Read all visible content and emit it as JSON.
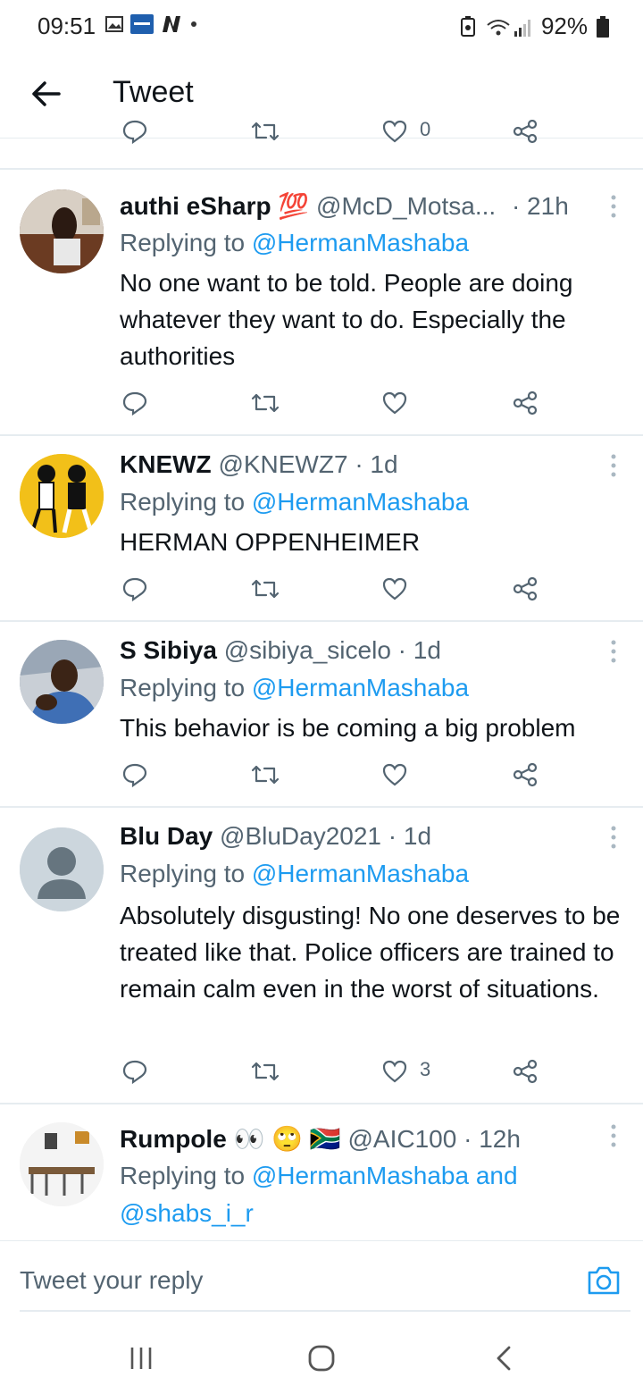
{
  "status_bar": {
    "time": "09:51",
    "battery": "92%"
  },
  "header": {
    "title": "Tweet"
  },
  "top_actions": {
    "like_count": "0"
  },
  "tweets": [
    {
      "name": "authi eSharp",
      "emoji": "💯",
      "handle": "@McD_Motsa...",
      "time": "· 21h",
      "replying_prefix": "Replying to ",
      "replying_to": "@HermanMashaba",
      "text": "No one want to be told.  People are doing whatever they want to do. Especially the authorities",
      "like_count": ""
    },
    {
      "name": "KNEWZ",
      "emoji": "",
      "handle": "@KNEWZ7",
      "time": "· 1d",
      "replying_prefix": "Replying to ",
      "replying_to": "@HermanMashaba",
      "text": "HERMAN OPPENHEIMER",
      "like_count": ""
    },
    {
      "name": "S Sibiya",
      "emoji": "",
      "handle": "@sibiya_sicelo",
      "time": "· 1d",
      "replying_prefix": "Replying to ",
      "replying_to": "@HermanMashaba",
      "text": "This behavior is be coming a big problem",
      "like_count": ""
    },
    {
      "name": "Blu Day",
      "emoji": "",
      "handle": "@BluDay2021",
      "time": "· 1d",
      "replying_prefix": "Replying to ",
      "replying_to": "@HermanMashaba",
      "text": "Absolutely disgusting! No one deserves to be treated like that. Police officers are trained to remain calm even in the worst of situations.",
      "like_count": "3"
    },
    {
      "name": "Rumpole",
      "emoji": "👀 🙄 🇿🇦",
      "handle": "@AIC100",
      "time": "· 12h",
      "replying_prefix": "Replying to ",
      "replying_to": "@HermanMashaba and",
      "replying_to_2": "@shabs_i_r",
      "text": "",
      "like_count": ""
    }
  ],
  "composer": {
    "placeholder": "Tweet your reply"
  },
  "colors": {
    "accent": "#1d9bf0",
    "muted": "#536471",
    "divider": "#e6ecf0"
  },
  "icons": [
    "back-arrow-icon",
    "reply-icon",
    "retweet-icon",
    "like-icon",
    "share-icon",
    "more-icon",
    "camera-icon",
    "recents-icon",
    "home-icon",
    "back-icon"
  ]
}
